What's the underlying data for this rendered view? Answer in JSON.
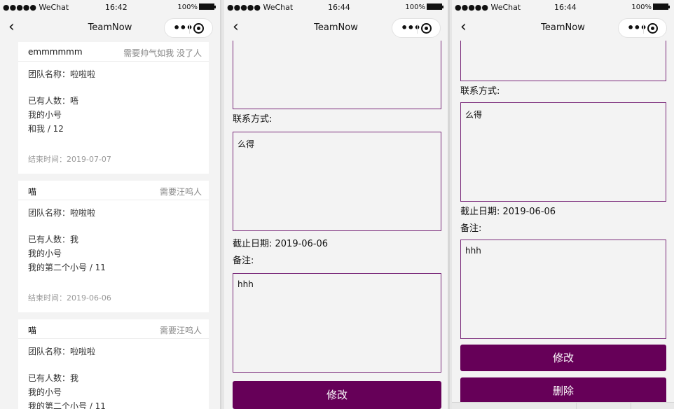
{
  "phones": [
    {
      "status": {
        "carrier": "●●●●● WeChat",
        "time": "16:42",
        "battery": "100%"
      },
      "nav_title": "TeamNow"
    },
    {
      "status": {
        "carrier": "●●●●● WeChat",
        "time": "16:44",
        "battery": "100%"
      },
      "nav_title": "TeamNow"
    },
    {
      "status": {
        "carrier": "●●●●● WeChat",
        "time": "16:44",
        "battery": "100%"
      },
      "nav_title": "TeamNow"
    }
  ],
  "cards": [
    {
      "name": "emmmmmm",
      "need": "需要帅气如我 没了人",
      "team": "团队名称：啦啦啦",
      "members": "已有人数：唔\n我的小号\n和我 / 12",
      "end": "结束时间：2019-07-07"
    },
    {
      "name": "喵",
      "need": "需要汪呜人",
      "team": "团队名称：啦啦啦",
      "members": "已有人数：我\n我的小号\n我的第二个小号 / 11",
      "end": "结束时间：2019-06-06"
    },
    {
      "name": "喵",
      "need": "需要汪呜人",
      "team": "团队名称：啦啦啦",
      "members": "已有人数：我\n我的小号\n我的第二个小号 / 11",
      "end": ""
    }
  ],
  "detail": {
    "contact_label": "联系方式:",
    "contact_value": "么得",
    "deadline": "截止日期: 2019-06-06",
    "note_label": "备注:",
    "note_value": "hhh",
    "edit_button": "修改",
    "delete_button": "删除"
  },
  "colors": {
    "accent": "#660058",
    "border": "#7b2b7b"
  }
}
